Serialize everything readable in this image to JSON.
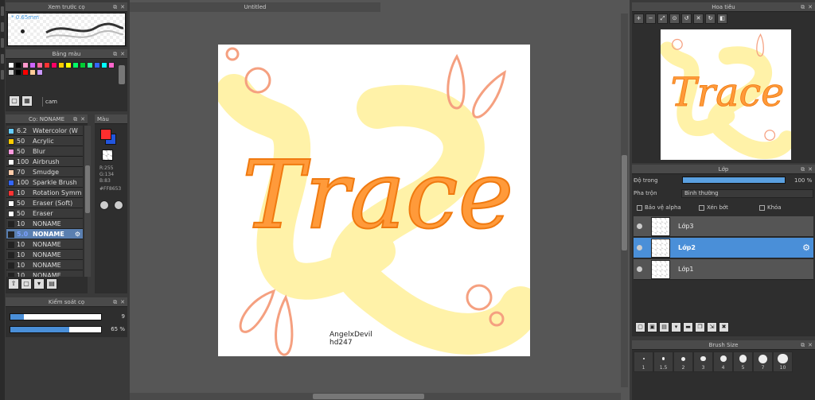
{
  "preview": {
    "title": "Xem trước cọ",
    "size": "* 0.65mm"
  },
  "palette": {
    "title": "Bảng màu",
    "name": "cam",
    "swatches": [
      "#ffffff",
      "#000000",
      "#ff99cc",
      "#cc66ff",
      "#ff6699",
      "#ff3333",
      "#ff0066",
      "#ffcc00",
      "#ffff00",
      "#00ff66",
      "#00cc33",
      "#33ff99",
      "#3366ff",
      "#00ffff",
      "#ff66cc",
      "#cccccc",
      "#000000",
      "#ff0000",
      "#ffcc99",
      "#cc99ff"
    ]
  },
  "brushes": {
    "title": "Cọ: NONAME",
    "items": [
      {
        "size": "6.2",
        "name": "Watercolor (W",
        "color": "#66ccff"
      },
      {
        "size": "50",
        "name": "Acrylic",
        "color": "#ffcc00"
      },
      {
        "size": "50",
        "name": "Blur",
        "color": "#ff99dd"
      },
      {
        "size": "100",
        "name": "Airbrush",
        "color": "#ffffff"
      },
      {
        "size": "70",
        "name": "Smudge",
        "color": "#ffccaa"
      },
      {
        "size": "100",
        "name": "Sparkle Brush",
        "color": "#3366ff"
      },
      {
        "size": "10",
        "name": "Rotation Symm",
        "color": "#ff3333"
      },
      {
        "size": "50",
        "name": "Eraser (Soft)",
        "color": "#ffffff"
      },
      {
        "size": "50",
        "name": "Eraser",
        "color": "#ffffff"
      },
      {
        "size": "10",
        "name": "NONAME",
        "color": "#222222"
      },
      {
        "size": "5.0",
        "name": "NONAME",
        "color": "#222222",
        "selected": true
      },
      {
        "size": "10",
        "name": "NONAME",
        "color": "#222222"
      },
      {
        "size": "10",
        "name": "NONAME",
        "color": "#222222"
      },
      {
        "size": "10",
        "name": "NONAME",
        "color": "#222222"
      },
      {
        "size": "10",
        "name": "NONAME",
        "color": "#222222"
      }
    ]
  },
  "color": {
    "title": "Màu",
    "r": "R:255",
    "g": "G:134",
    "b": "B:83",
    "hex": "#FF8653"
  },
  "control": {
    "title": "Kiểm soát cọ",
    "size_value": "9",
    "size_pct": 0.15,
    "opacity_value": "65 %",
    "opacity_pct": 0.65
  },
  "canvas": {
    "tab": "Untitled",
    "sig1": "AngelxDevil",
    "sig2": "hd247",
    "text": "Trace"
  },
  "navigator": {
    "title": "Hoa tiêu"
  },
  "layers": {
    "title": "Lớp",
    "opacity_label": "Độ trong",
    "opacity_value": "100 %",
    "blend_label": "Pha trộn",
    "blend_value": "Bình thường",
    "alpha_label": "Bảo vệ alpha",
    "clip_label": "Xén bớt",
    "lock_label": "Khóa",
    "items": [
      {
        "name": "Lớp3"
      },
      {
        "name": "Lớp2",
        "selected": true
      },
      {
        "name": "Lớp1"
      }
    ]
  },
  "brush_size": {
    "title": "Brush Size",
    "sizes": [
      "1",
      "1.5",
      "2",
      "3",
      "4",
      "5",
      "7",
      "10"
    ]
  },
  "colors": {
    "accent": "#4a8fd8",
    "orange": "#ff8653",
    "yellow": "#fff2a8"
  }
}
